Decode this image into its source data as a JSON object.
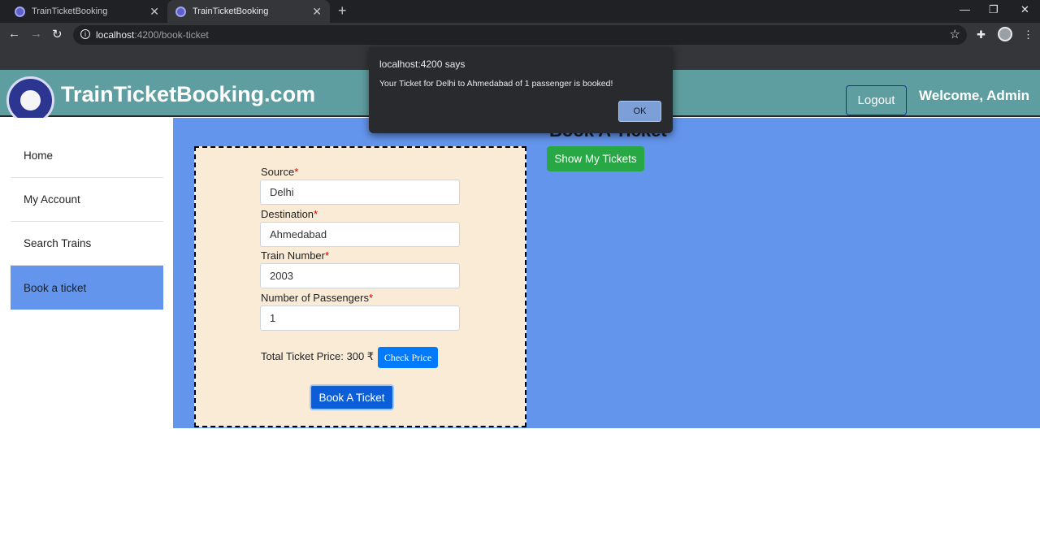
{
  "browser": {
    "tabs": [
      {
        "title": "TrainTicketBooking",
        "active": false
      },
      {
        "title": "TrainTicketBooking",
        "active": true
      }
    ],
    "url_host": "localhost",
    "url_path": ":4200/book-ticket"
  },
  "header": {
    "brand": "TrainTicketBooking.com",
    "logout_label": "Logout",
    "welcome": "Welcome, Admin",
    "color": "#5f9ea0"
  },
  "sidebar": {
    "items": [
      {
        "label": "Home",
        "active": false
      },
      {
        "label": "My Account",
        "active": false
      },
      {
        "label": "Search Trains",
        "active": false
      },
      {
        "label": "Book a ticket",
        "active": true
      }
    ],
    "active_color": "#6495ed"
  },
  "main": {
    "heading": "Book A Ticket",
    "show_tickets_label": "Show My Tickets",
    "background": "#6495ed"
  },
  "form": {
    "source_label": "Source",
    "source_value": "Delhi",
    "destination_label": "Destination",
    "destination_value": "Ahmedabad",
    "train_number_label": "Train Number",
    "train_number_value": "2003",
    "passengers_label": "Number of Passengers",
    "passengers_value": "1",
    "required_mark": "*",
    "price_text": "Total Ticket Price: 300 ₹",
    "check_price_label": "Check Price",
    "book_label": "Book A Ticket",
    "background": "#faebd7"
  },
  "dialog": {
    "title": "localhost:4200 says",
    "message": "Your Ticket for Delhi to Ahmedabad of 1 passenger is booked!",
    "ok_label": "OK"
  }
}
